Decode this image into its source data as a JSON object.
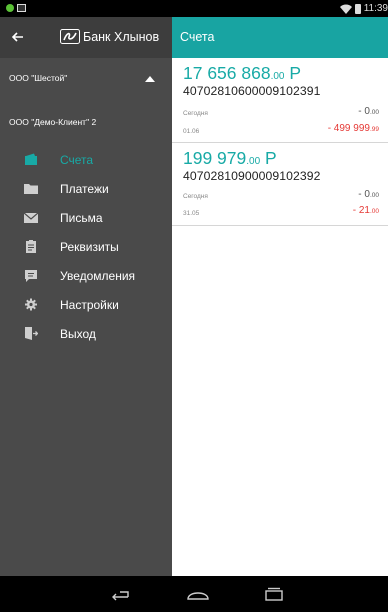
{
  "status_bar": {
    "time": "11:39"
  },
  "drawer": {
    "brand_title": "Банк Хлынов",
    "organizations": [
      {
        "name": "ООО \"Шестой\""
      },
      {
        "name": "ООО \"Демо-Клиент\" 2"
      }
    ],
    "menu": [
      {
        "label": "Счета",
        "icon": "wallet-icon",
        "active": true
      },
      {
        "label": "Платежи",
        "icon": "folder-icon",
        "active": false
      },
      {
        "label": "Письма",
        "icon": "envelope-icon",
        "active": false
      },
      {
        "label": "Реквизиты",
        "icon": "clipboard-icon",
        "active": false
      },
      {
        "label": "Уведомления",
        "icon": "chat-icon",
        "active": false
      },
      {
        "label": "Настройки",
        "icon": "gear-icon",
        "active": false
      },
      {
        "label": "Выход",
        "icon": "exit-door-icon",
        "active": false
      }
    ]
  },
  "toolbar": {
    "title": "Счета"
  },
  "accounts": [
    {
      "balance_int": "17 656 868",
      "balance_dec": ".00",
      "currency": "Р",
      "number": "40702810600009102391",
      "today_label": "Сегодня",
      "today_int": "- 0",
      "today_dec": ".00",
      "date_label": "01.06",
      "date_int": "- 499 999",
      "date_dec": ".99"
    },
    {
      "balance_int": "199 979",
      "balance_dec": ".00",
      "currency": "Р",
      "number": "40702810900009102392",
      "today_label": "Сегодня",
      "today_int": "- 0",
      "today_dec": ".00",
      "date_label": "31.05",
      "date_int": "- 21",
      "date_dec": ".00"
    }
  ],
  "colors": {
    "accent": "#18a4a2",
    "drawer_bg": "#4a4a4a",
    "negative": "#e53935"
  }
}
